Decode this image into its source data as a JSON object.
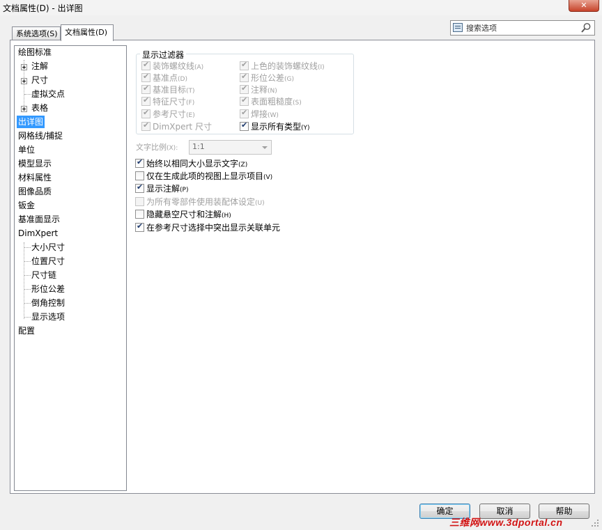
{
  "window": {
    "title": "文档属性(D) - 出详图",
    "close_glyph": "✕"
  },
  "tabs": [
    {
      "label": "系统选项(S)"
    },
    {
      "label": "文档属性(D)"
    }
  ],
  "search": {
    "placeholder": "搜索选项",
    "icon": "magnifier-icon"
  },
  "tree": {
    "items": [
      {
        "label": "绘图标准"
      },
      {
        "label": "注解"
      },
      {
        "label": "尺寸"
      },
      {
        "label": "虚拟交点"
      },
      {
        "label": "表格"
      },
      {
        "label": "出详图"
      },
      {
        "label": "网格线/捕捉"
      },
      {
        "label": "单位"
      },
      {
        "label": "模型显示"
      },
      {
        "label": "材料属性"
      },
      {
        "label": "图像品质"
      },
      {
        "label": "钣金"
      },
      {
        "label": "基准面显示"
      },
      {
        "label": "DimXpert"
      },
      {
        "label": "大小尺寸"
      },
      {
        "label": "位置尺寸"
      },
      {
        "label": "尺寸链"
      },
      {
        "label": "形位公差"
      },
      {
        "label": "倒角控制"
      },
      {
        "label": "显示选项"
      },
      {
        "label": "配置"
      }
    ]
  },
  "filter": {
    "title": "显示过滤器",
    "left": [
      {
        "label": "装饰螺纹线",
        "key": "(A)",
        "checked": true
      },
      {
        "label": "基准点",
        "key": "(D)",
        "checked": true
      },
      {
        "label": "基准目标",
        "key": "(T)",
        "checked": true
      },
      {
        "label": "特征尺寸",
        "key": "(F)",
        "checked": true
      },
      {
        "label": "参考尺寸",
        "key": "(E)",
        "checked": true
      },
      {
        "label": "DimXpert 尺寸",
        "key": "",
        "checked": true
      }
    ],
    "right": [
      {
        "label": "上色的装饰螺纹线",
        "key": "(I)",
        "checked": true
      },
      {
        "label": "形位公差",
        "key": "(G)",
        "checked": true
      },
      {
        "label": "注释",
        "key": "(N)",
        "checked": true
      },
      {
        "label": "表面粗糙度",
        "key": "(S)",
        "checked": true
      },
      {
        "label": "焊接",
        "key": "(W)",
        "checked": true
      },
      {
        "label": "显示所有类型",
        "key": "(Y)",
        "checked": true
      }
    ]
  },
  "text_scale": {
    "label": "文字比例",
    "key": "(X):",
    "value": "1:1"
  },
  "options": [
    {
      "label": "始终以相同大小显示文字",
      "key": "(Z)",
      "checked": true,
      "enabled": true
    },
    {
      "label": "仅在生成此项的视图上显示项目",
      "key": "(V)",
      "checked": false,
      "enabled": true
    },
    {
      "label": "显示注解",
      "key": "(P)",
      "checked": true,
      "enabled": true
    },
    {
      "label": "为所有零部件使用装配体设定",
      "key": "(U)",
      "checked": false,
      "enabled": false
    },
    {
      "label": "隐藏悬空尺寸和注解",
      "key": "(H)",
      "checked": false,
      "enabled": true
    },
    {
      "label": "在参考尺寸选择中突出显示关联单元",
      "key": "",
      "checked": true,
      "enabled": true
    }
  ],
  "buttons": {
    "ok": "确定",
    "cancel": "取消",
    "help": "帮助"
  },
  "watermark": "三维网www.3dportal.cn"
}
